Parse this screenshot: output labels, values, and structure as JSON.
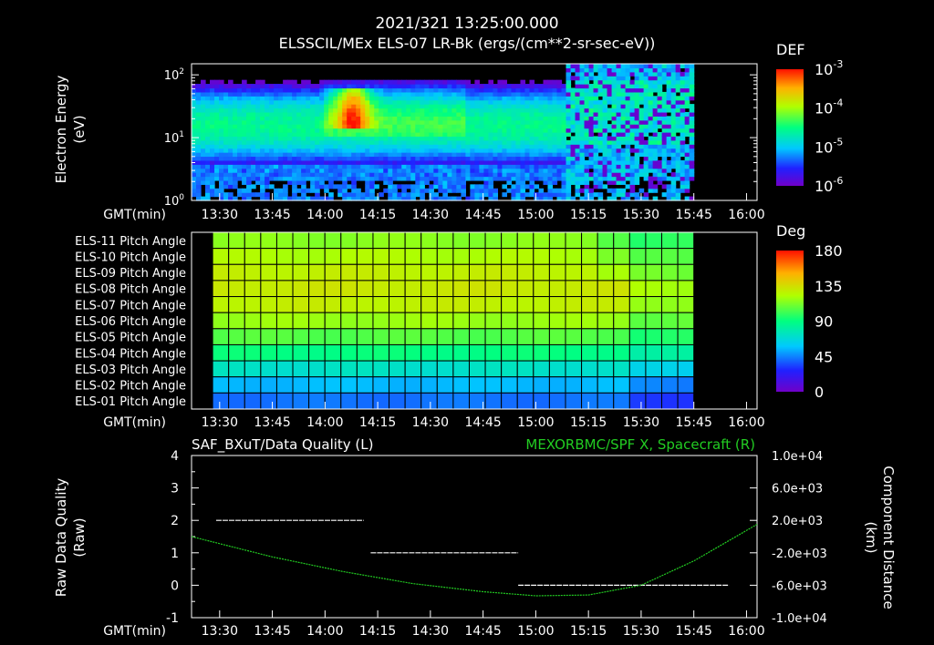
{
  "header": {
    "datetime": "2021/321 13:25:00.000",
    "title": "ELSSCIL/MEx ELS-07 LR-Bk  (ergs/(cm**2-sr-sec-eV))"
  },
  "time_axis": {
    "label": "GMT(min)",
    "ticks": [
      "13:30",
      "13:45",
      "14:00",
      "14:15",
      "14:30",
      "14:45",
      "15:00",
      "15:15",
      "15:30",
      "15:45",
      "16:00"
    ]
  },
  "colors": {
    "qualityLine": "#ffffff",
    "spacecraftLine": "#22cc22",
    "rightLabel": "#22cc22"
  },
  "chart_data": [
    {
      "type": "heatmap",
      "name": "spectrogram",
      "ylabel": [
        "Electron Energy",
        "(eV)"
      ],
      "y_scale": "log",
      "ylim": [
        1,
        150
      ],
      "y_tick_labels": [
        "10^0",
        "10^1",
        "10^2"
      ],
      "xlim": [
        "13:22",
        "16:03"
      ],
      "data_extent": [
        "13:22",
        "15:45"
      ],
      "colorbar": {
        "label": "DEF",
        "scale": "log",
        "range": [
          1e-06,
          0.001
        ],
        "tick_labels": [
          "10^-3",
          "10^-4",
          "10^-5",
          "10^-6"
        ]
      },
      "features": [
        {
          "time": "14:08",
          "energy_eV": [
            20,
            60
          ],
          "level": "10^-3 peak"
        },
        {
          "time": "13:22-15:05",
          "energy_eV": [
            6,
            40
          ],
          "level": "10^-4.5 band"
        },
        {
          "time": "15:15-15:45",
          "energy_eV": [
            3,
            100
          ],
          "level": "sparse 10^-5"
        }
      ]
    },
    {
      "type": "heatmap",
      "name": "pitch-angle",
      "row_labels": [
        "ELS-11 Pitch Angle",
        "ELS-10 Pitch Angle",
        "ELS-09 Pitch Angle",
        "ELS-08 Pitch Angle",
        "ELS-07 Pitch Angle",
        "ELS-06 Pitch Angle",
        "ELS-05 Pitch Angle",
        "ELS-04 Pitch Angle",
        "ELS-03 Pitch Angle",
        "ELS-02 Pitch Angle",
        "ELS-01 Pitch Angle"
      ],
      "xlim": [
        "13:22",
        "16:03"
      ],
      "data_extent": [
        "13:28",
        "15:45"
      ],
      "columns": 30,
      "row_angles_deg": [
        115,
        122,
        128,
        131,
        128,
        118,
        105,
        90,
        72,
        55,
        42
      ],
      "colorbar": {
        "label": "Deg",
        "range": [
          0,
          180
        ],
        "tick_labels": [
          "180",
          "135",
          "90",
          "45",
          "0"
        ]
      }
    },
    {
      "type": "line",
      "name": "quality-and-position",
      "title_left": "SAF_BXuT/Data Quality (L)",
      "title_right": "MEXORBMC/SPF X, Spacecraft (R)",
      "ylabel_left": [
        "Raw Data Quality",
        "(Raw)"
      ],
      "ylabel_right": [
        "Component Distance",
        "(km)"
      ],
      "ylim_left": [
        -1,
        4
      ],
      "yticks_left": [
        "4",
        "3",
        "2",
        "1",
        "0",
        "-1"
      ],
      "ylim_right": [
        -10000,
        10000
      ],
      "yticks_right": [
        "1.0e+04",
        "6.0e+03",
        "2.0e+03",
        "-2.0e+03",
        "-6.0e+03",
        "-1.0e+04"
      ],
      "xlim": [
        "13:22",
        "16:03"
      ],
      "series": [
        {
          "axis": "left",
          "segments": [
            {
              "start": "13:29",
              "end": "14:11",
              "value": 2
            },
            {
              "start": "14:13",
              "end": "14:55",
              "value": 1
            },
            {
              "start": "14:55",
              "end": "15:55",
              "value": 0
            }
          ]
        },
        {
          "axis": "right",
          "points": [
            [
              "13:22",
              0
            ],
            [
              "13:45",
              -2500
            ],
            [
              "14:05",
              -4300
            ],
            [
              "14:25",
              -5800
            ],
            [
              "14:45",
              -6800
            ],
            [
              "15:00",
              -7300
            ],
            [
              "15:15",
              -7200
            ],
            [
              "15:30",
              -6000
            ],
            [
              "15:45",
              -3000
            ],
            [
              "16:03",
              1500
            ]
          ]
        }
      ]
    }
  ]
}
